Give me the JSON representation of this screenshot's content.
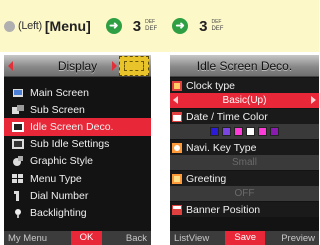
{
  "instruction": {
    "prefix": "(Left)",
    "menu_key": "[Menu]",
    "step1_num": "3",
    "step1_sub_top": "DEF",
    "step1_sub_bottom": "DEF",
    "step2_num": "3",
    "step2_sub_top": "DEF",
    "step2_sub_bottom": "DEF",
    "nav_icon": "nav-arrow-icon"
  },
  "left_screen": {
    "title": "Display",
    "menu": [
      {
        "label": "Main Screen",
        "icon": "main-screen-icon",
        "selected": false
      },
      {
        "label": "Sub Screen",
        "icon": "sub-screen-icon",
        "selected": false
      },
      {
        "label": "Idle Screen Deco.",
        "icon": "idle-deco-icon",
        "selected": true
      },
      {
        "label": "Sub Idle Settings",
        "icon": "sub-idle-icon",
        "selected": false
      },
      {
        "label": "Graphic Style",
        "icon": "graphic-style-icon",
        "selected": false
      },
      {
        "label": "Menu Type",
        "icon": "menu-type-icon",
        "selected": false
      },
      {
        "label": "Dial Number",
        "icon": "dial-number-icon",
        "selected": false
      },
      {
        "label": "Backlighting",
        "icon": "backlight-icon",
        "selected": false
      }
    ],
    "softkeys": {
      "left": "My Menu",
      "center": "OK",
      "right": "Back"
    }
  },
  "right_screen": {
    "title": "Idle Screen Deco.",
    "clock_type_label": "Clock type",
    "clock_type_value": "Basic(Up)",
    "date_time_color_label": "Date / Time Color",
    "colors": [
      "#2b1bd6",
      "#7a45e0",
      "#ff3bd8",
      "#ffffff",
      "#ff3bd8",
      "#8a1bb0"
    ],
    "navi_key_label": "Navi. Key Type",
    "navi_key_value": "Small",
    "greeting_label": "Greeting",
    "greeting_value": "OFF",
    "banner_label": "Banner Position",
    "softkeys": {
      "left": "ListView",
      "center": "Save",
      "right": "Preview"
    }
  },
  "colors": {
    "instruction_bg": "#fdf8c8",
    "accent_red": "#e82838",
    "screen_bg": "#131313",
    "nav_green": "#2ea043"
  }
}
